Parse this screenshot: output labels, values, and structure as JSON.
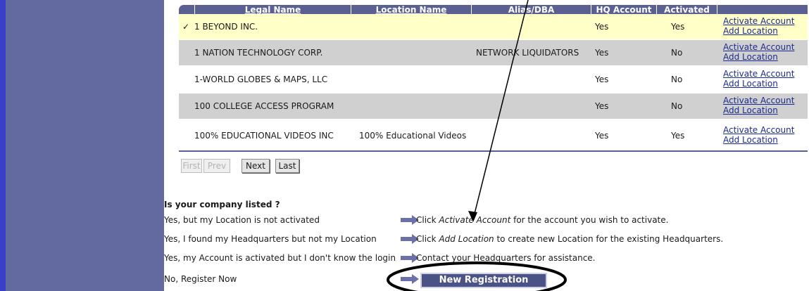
{
  "table": {
    "headers": {
      "legal_name": "Legal Name",
      "location_name": "Location Name",
      "alias": "Alias/DBA",
      "hq_account": "HQ Account",
      "activated": "Activated"
    },
    "rows": [
      {
        "selected": true,
        "check": "✓",
        "legal_name": "1 BEYOND INC.",
        "location_name": "",
        "alias": "",
        "hq_account": "Yes",
        "activated": "Yes",
        "activate_link": "Activate Account",
        "add_link": "Add Location"
      },
      {
        "selected": false,
        "check": "",
        "legal_name": "1 NATION TECHNOLOGY CORP.",
        "location_name": "",
        "alias": "NETWORK LIQUIDATORS",
        "hq_account": "Yes",
        "activated": "No",
        "activate_link": "Activate Account",
        "add_link": "Add Location"
      },
      {
        "selected": false,
        "check": "",
        "legal_name": "1-WORLD GLOBES & MAPS, LLC",
        "location_name": "",
        "alias": "",
        "hq_account": "Yes",
        "activated": "No",
        "activate_link": "Activate Account",
        "add_link": "Add Location"
      },
      {
        "selected": false,
        "check": "",
        "legal_name": "100 COLLEGE ACCESS PROGRAM",
        "location_name": "",
        "alias": "",
        "hq_account": "Yes",
        "activated": "No",
        "activate_link": "Activate Account",
        "add_link": "Add Location"
      },
      {
        "selected": false,
        "check": "",
        "legal_name": "100% EDUCATIONAL VIDEOS INC",
        "location_name": "100% Educational Videos",
        "alias": "",
        "hq_account": "Yes",
        "activated": "Yes",
        "activate_link": "Activate Account",
        "add_link": "Add Location"
      }
    ]
  },
  "pager": {
    "first": "First",
    "prev": "Prev",
    "next": "Next",
    "last": "Last"
  },
  "help": {
    "title": "Is your company listed ?",
    "rows": [
      {
        "question": "Yes, but my Location is not activated",
        "pre": "Click ",
        "em": "Activate Account",
        "post": " for the account you wish to activate."
      },
      {
        "question": "Yes, I found my Headquarters but not my Location",
        "pre": "Click ",
        "em": "Add Location",
        "post": " to create new Location for the existing Headquarters."
      },
      {
        "question": "Yes, my Account is activated but I don't know the login",
        "pre": "Contact your Headquarters for assistance.",
        "em": "",
        "post": ""
      },
      {
        "question": "No, Register Now",
        "pre": "",
        "em": "",
        "post": ""
      }
    ],
    "new_registration": "New Registration"
  },
  "colors": {
    "sidebar": "#636a9f",
    "header": "#5a6092",
    "selected_row": "#ffffc8",
    "shaded_row": "#d0d0d0",
    "link": "#1c2b8f",
    "arrow": "#6b70a8"
  },
  "icons": {
    "arrow": "right-arrow-icon",
    "check": "check-icon"
  }
}
